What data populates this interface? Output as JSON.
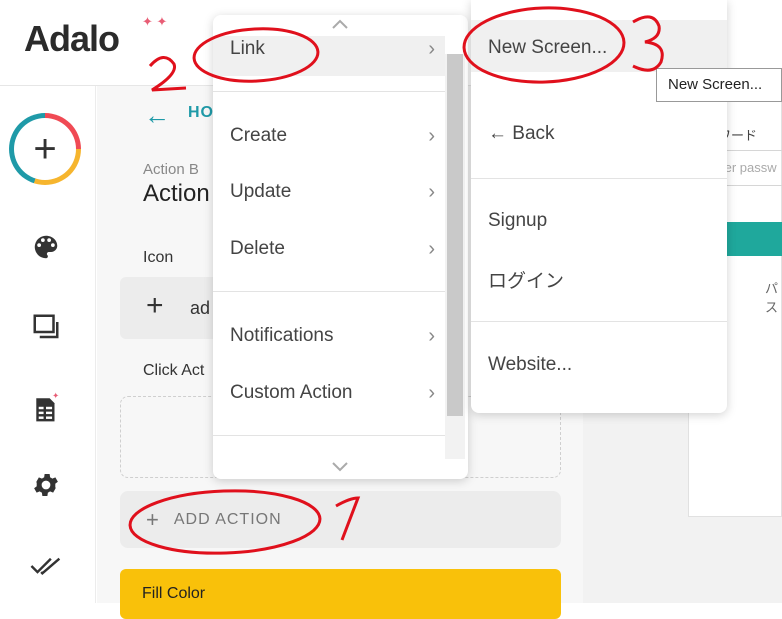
{
  "logo": {
    "text": "Adalo",
    "stars": "✦ ✦"
  },
  "rail": {
    "add_symbol": "+",
    "icons": [
      "palette-icon",
      "screens-icon",
      "database-icon",
      "settings-icon",
      "publish-check-icon"
    ]
  },
  "panel": {
    "back_arrow": "←",
    "back_label": "HO",
    "action_subtitle": "Action B",
    "action_title": "Action",
    "icon_label": "Icon",
    "icon_plus": "+",
    "icon_value": "ad",
    "click_actions_label": "Click Act",
    "add_action_plus": "+",
    "add_action_label": "ADD ACTION",
    "fill_color_label": "Fill Color"
  },
  "canvas": {
    "password_label": "ワード",
    "password_placeholder": "ter passw",
    "small_text": "パス"
  },
  "menu1": {
    "items": [
      {
        "label": "Link",
        "chevron": "›"
      },
      {
        "label": "Create",
        "chevron": "›"
      },
      {
        "label": "Update",
        "chevron": "›"
      },
      {
        "label": "Delete",
        "chevron": "›"
      },
      {
        "label": "Notifications",
        "chevron": "›"
      },
      {
        "label": "Custom Action",
        "chevron": "›"
      }
    ],
    "scroll_up": "⌃",
    "scroll_down": "⌄"
  },
  "menu2": {
    "items": [
      {
        "label": "New Screen..."
      },
      {
        "label": "← Back"
      },
      {
        "label": "Signup"
      },
      {
        "label": "ログイン"
      },
      {
        "label": "Website..."
      }
    ]
  },
  "tooltip": {
    "text": "New Screen..."
  },
  "annotations": {
    "marks": [
      "1",
      "2",
      "3"
    ],
    "color": "#e0101c"
  }
}
